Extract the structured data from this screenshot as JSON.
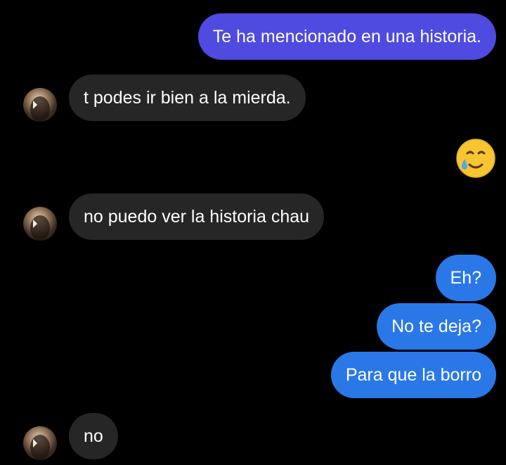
{
  "messages": [
    {
      "sender": "me",
      "text": "Te ha mencionado en una historia."
    },
    {
      "sender": "them",
      "text": "t podes ir bien a la mierda."
    },
    {
      "sender": "me",
      "type": "emoji",
      "icon": "smiling-face-with-tear-icon"
    },
    {
      "sender": "them",
      "text": "no puedo ver la historia chau"
    },
    {
      "sender": "me",
      "text": "Eh?"
    },
    {
      "sender": "me",
      "text": "No te deja?"
    },
    {
      "sender": "me",
      "text": "Para que la borro"
    },
    {
      "sender": "them",
      "text": "no"
    }
  ],
  "colors": {
    "background": "#000000",
    "incoming_bubble": "#262626",
    "story_mention_bubble": "#4f4ae0",
    "outgoing_bubble": "#2a78e8",
    "text": "#ffffff"
  }
}
